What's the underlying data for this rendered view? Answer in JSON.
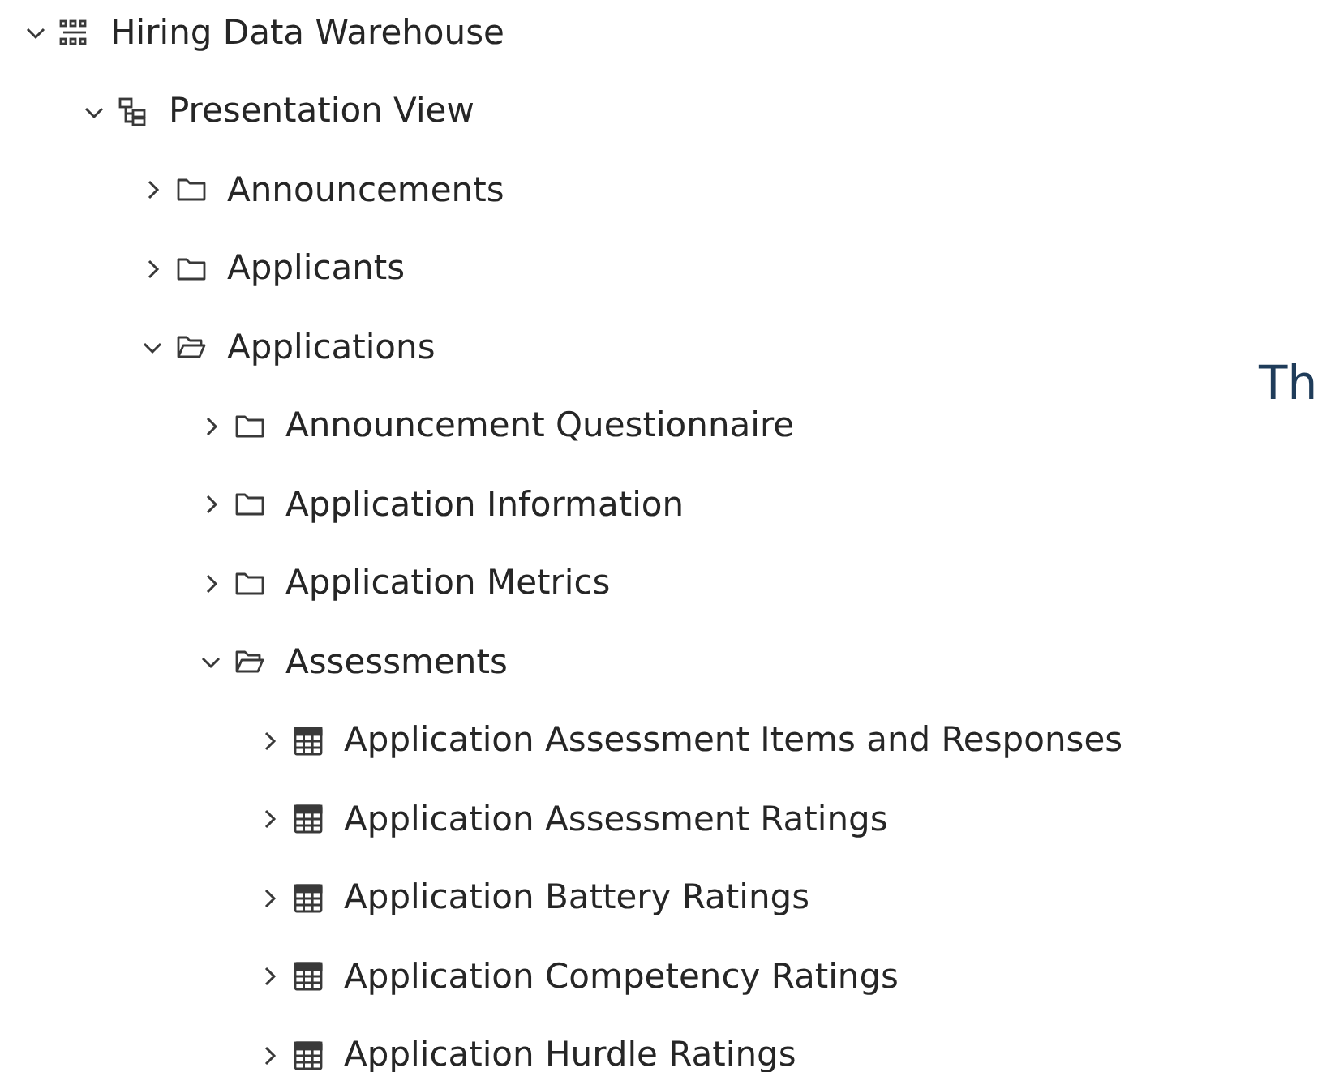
{
  "tree": [
    {
      "label": "Hiring Data Warehouse",
      "kind": "model",
      "expanded": true,
      "children": [
        {
          "label": "Presentation View",
          "kind": "view",
          "expanded": true,
          "children": [
            {
              "label": "Announcements",
              "kind": "folder",
              "expanded": false
            },
            {
              "label": "Applicants",
              "kind": "folder",
              "expanded": false
            },
            {
              "label": "Applications",
              "kind": "folder",
              "expanded": true,
              "children": [
                {
                  "label": "Announcement Questionnaire",
                  "kind": "folder",
                  "expanded": false
                },
                {
                  "label": "Application Information",
                  "kind": "folder",
                  "expanded": false
                },
                {
                  "label": "Application Metrics",
                  "kind": "folder",
                  "expanded": false
                },
                {
                  "label": "Assessments",
                  "kind": "folder",
                  "expanded": true,
                  "children": [
                    {
                      "label": "Application Assessment Items and Responses",
                      "kind": "table",
                      "expanded": false
                    },
                    {
                      "label": "Application Assessment Ratings",
                      "kind": "table",
                      "expanded": false
                    },
                    {
                      "label": "Application Battery Ratings",
                      "kind": "table",
                      "expanded": false
                    },
                    {
                      "label": "Application Competency Ratings",
                      "kind": "table",
                      "expanded": false
                    },
                    {
                      "label": "Application Hurdle Ratings",
                      "kind": "table",
                      "expanded": false
                    }
                  ]
                }
              ]
            }
          ]
        }
      ]
    }
  ],
  "heading": "Th"
}
